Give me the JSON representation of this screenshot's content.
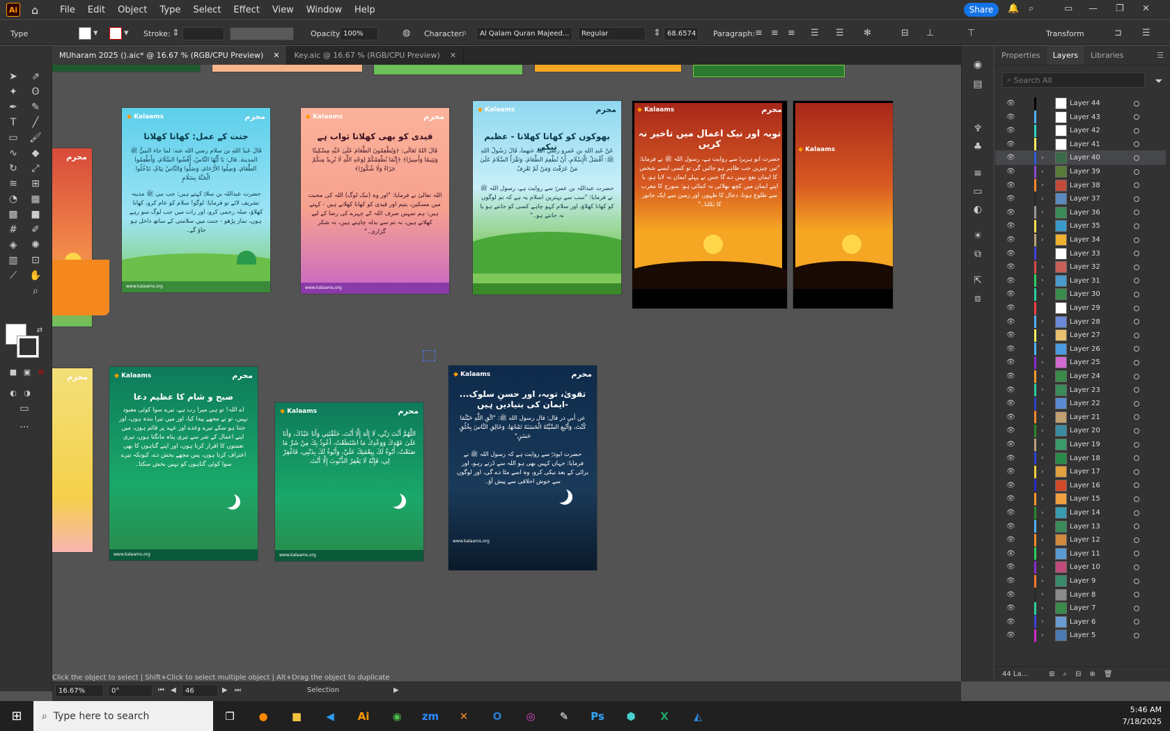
{
  "app": {
    "logo": "Ai",
    "menus": [
      "File",
      "Edit",
      "Object",
      "Type",
      "Select",
      "Effect",
      "View",
      "Window",
      "Help"
    ],
    "share": "Share"
  },
  "control": {
    "mode": "Type",
    "stroke_label": "Stroke:",
    "opacity_label": "Opacity:",
    "opacity": "100%",
    "character_label": "Character:",
    "font": "Al Qalam Quran Majeed...",
    "style": "Regular",
    "size": "68.6574 p",
    "paragraph_label": "Paragraph:",
    "transform": "Transform"
  },
  "tabs": [
    {
      "label": "MUharam 2025 ().aic* @ 16.67 % (RGB/CPU Preview)"
    },
    {
      "label": "Key.aic @ 16.67 % (RGB/CPU Preview)"
    }
  ],
  "panel": {
    "tabs": [
      "Properties",
      "Layers",
      "Libraries"
    ],
    "search_placeholder": "Search All",
    "footer": "44 La..."
  },
  "layers": [
    {
      "name": "Layer 44",
      "color": "#000000",
      "thumb": "#ffffff",
      "arrow": ""
    },
    {
      "name": "Layer 43",
      "color": "#4fb3ff",
      "thumb": "#ffffff",
      "arrow": ""
    },
    {
      "name": "Layer 42",
      "color": "#2bd6c8",
      "thumb": "#ffffff",
      "arrow": ""
    },
    {
      "name": "Layer 41",
      "color": "#ffef5c",
      "thumb": "#ffffff",
      "arrow": ""
    },
    {
      "name": "Layer 40",
      "color": "#2e5bd8",
      "thumb": "#3a6a4a",
      "arrow": "›",
      "selected": true
    },
    {
      "name": "Layer 39",
      "color": "#8a4ad0",
      "thumb": "#5a7a3a",
      "arrow": "›"
    },
    {
      "name": "Layer 38",
      "color": "#ff8a2b",
      "thumb": "#c24a3a",
      "arrow": "›"
    },
    {
      "name": "Layer 37",
      "color": "#2a2a2a",
      "thumb": "#5a8abf",
      "arrow": "›"
    },
    {
      "name": "Layer 36",
      "color": "#9a9a9a",
      "thumb": "#3a8a5a",
      "arrow": "›"
    },
    {
      "name": "Layer 35",
      "color": "#ffe04a",
      "thumb": "#3a9ac8",
      "arrow": "›"
    },
    {
      "name": "Layer 34",
      "color": "#bba37a",
      "thumb": "#f0b030",
      "arrow": "›"
    },
    {
      "name": "Layer 33",
      "color": "#4040e0",
      "thumb": "#ffffff",
      "arrow": ""
    },
    {
      "name": "Layer 32",
      "color": "#e04a4a",
      "thumb": "#c8605a",
      "arrow": "›"
    },
    {
      "name": "Layer 31",
      "color": "#2ad060",
      "thumb": "#4a9acb",
      "arrow": "›"
    },
    {
      "name": "Layer 30",
      "color": "#2ad0a0",
      "thumb": "#3a8a4a",
      "arrow": "›"
    },
    {
      "name": "Layer 29",
      "color": "#ff4040",
      "thumb": "#ffffff",
      "arrow": ""
    },
    {
      "name": "Layer 28",
      "color": "#4fb3ff",
      "thumb": "#6a8ad8",
      "arrow": "›"
    },
    {
      "name": "Layer 27",
      "color": "#ffef5c",
      "thumb": "#e8c070",
      "arrow": "›"
    },
    {
      "name": "Layer 26",
      "color": "#4fb3ff",
      "thumb": "#4a9ae0",
      "arrow": "›"
    },
    {
      "name": "Layer 25",
      "color": "#8a2ad0",
      "thumb": "#d06ad0",
      "arrow": "›"
    },
    {
      "name": "Layer 24",
      "color": "#ff9a2b",
      "thumb": "#3a8a4a",
      "arrow": "›"
    },
    {
      "name": "Layer 23",
      "color": "#2ad0a0",
      "thumb": "#3a8a5a",
      "arrow": "›"
    },
    {
      "name": "Layer 22",
      "color": "#2a40c8",
      "thumb": "#5a8ad0",
      "arrow": "›"
    },
    {
      "name": "Layer 21",
      "color": "#ff8a2b",
      "thumb": "#c0a070",
      "arrow": "›"
    },
    {
      "name": "Layer 20",
      "color": "#2a8a2a",
      "thumb": "#3a8aa0",
      "arrow": "›"
    },
    {
      "name": "Layer 19",
      "color": "#bba37a",
      "thumb": "#3a9a6a",
      "arrow": "›"
    },
    {
      "name": "Layer 18",
      "color": "#2a40e0",
      "thumb": "#2a8a4a",
      "arrow": "›"
    },
    {
      "name": "Layer 17",
      "color": "#ffd040",
      "thumb": "#e0a040",
      "arrow": "›"
    },
    {
      "name": "Layer 16",
      "color": "#2a2ad0",
      "thumb": "#d04a2a",
      "arrow": "›"
    },
    {
      "name": "Layer 15",
      "color": "#ff9a2b",
      "thumb": "#f0a040",
      "arrow": "›"
    },
    {
      "name": "Layer 14",
      "color": "#2a8a2a",
      "thumb": "#3a9ab0",
      "arrow": "›"
    },
    {
      "name": "Layer 13",
      "color": "#4fb3ff",
      "thumb": "#3a8a5a",
      "arrow": "›"
    },
    {
      "name": "Layer 12",
      "color": "#ff8a2b",
      "thumb": "#d08a40",
      "arrow": "›"
    },
    {
      "name": "Layer 11",
      "color": "#2ad060",
      "thumb": "#5a9ad0",
      "arrow": "›"
    },
    {
      "name": "Layer 10",
      "color": "#8a2ad0",
      "thumb": "#c04a7a",
      "arrow": "›"
    },
    {
      "name": "Layer 9",
      "color": "#ff7a2b",
      "thumb": "#3a8a6a",
      "arrow": "›"
    },
    {
      "name": "Layer 8",
      "color": "#2a2a2a",
      "thumb": "#8a8a8a",
      "arrow": "›"
    },
    {
      "name": "Layer 7",
      "color": "#2ad0a0",
      "thumb": "#3a8a4a",
      "arrow": "›"
    },
    {
      "name": "Layer 6",
      "color": "#4040e0",
      "thumb": "#6a9ad0",
      "arrow": "›"
    },
    {
      "name": "Layer 5",
      "color": "#d02ad0",
      "thumb": "#4a7ab0",
      "arrow": "›"
    }
  ],
  "artboards": [
    {
      "title": "جنت کے عمل: کھانا کھلانا",
      "body": "قَالَ عَبدُ اللهِ بن سلام رضي الله عنه: لما جاء النبيُّ ﷺ المدينة. قال: يَا أَيُّهَا النَّاسُ، أَفْشُوا السَّلَامَ، وَأَطْعِمُوا الطَّعَامَ، وَصِلُوا الأَرْحَامَ، وَصَلُّوا وَالنَّاسُ نِيَامٌ، تَدْخُلُوا الْجَنَّةَ بِسَلَامٍ",
      "body2": "حضرت عبداللہ بن سلامؓ کہتے ہیں: جب نبی ﷺ مدینہ تشریف لائے تو فرمایا: لوگو! سلام کو عام کرو، کھانا کھلاؤ، صلہ رحمی کرو، اور رات میں جب لوگ سو رہے ہوں، نماز پڑھو - جنت میں سلامتی کے ساتھ داخل ہو جاؤ گے۔"
    },
    {
      "title": "قیدی کو بھی کھلانا ثواب ہے",
      "body": "قَالَ اللهُ تَعَالَى: ﴿وَيُطْعِمُونَ الطَّعَامَ عَلَىٰ حُبِّهِ مِسْكِينًا وَيَتِيمًا وَأَسِيرًا﴾ ﴿إِنَّمَا نُطْعِمُكُمْ لِوَجْهِ اللَّهِ لَا نُرِيدُ مِنكُمْ جَزَاءً وَلَا شُكُورًا﴾",
      "body2": "اللہ تعالیٰ نے فرمایا: \"اور وہ (نیک لوگ) اللہ کی محبت میں مسکین، یتیم اور قیدی کو کھانا کھلاتے ہیں - کہتے ہیں: ہم تمہیں صرف اللہ کے چہرے کی رضا کے لیے کھلاتے ہیں، نہ تم سے بدلہ چاہتے ہیں، نہ شکر گزاری۔\""
    },
    {
      "title": "بھوکوں کو کھانا کھلانا - عظیم نیکی",
      "body": "عَنْ عَبدِ اللهِ بنِ عَمرو رضي الله عنهما، قَالَ رَسُولُ اللهِ ﷺ: أَفْضَلُ الْإِسْلَامِ، أَنْ تُطْعِمَ الطَّعَامَ، وَتَقْرَأَ السَّلَامَ عَلَىٰ مَنْ عَرَفْتَ وَمَنْ لَمْ تَعْرِفْ",
      "body2": "حضرت عبداللہ بن عمروؓ سے روایت ہے، رسول اللہ ﷺ نے فرمایا: \"سب سے بہترین اسلام یہ ہے کہ تم لوگوں کو کھانا کھلاؤ، اور سلام کہو چاہے کسی کو جانتے ہو یا نہ جانتے ہو۔\""
    },
    {
      "title": "توبہ اور نیک اعمال میں تاخیر نہ کریں",
      "body2": "حضرت ابو ہریرہؓ سے روایت ہے، رسول اللہ ﷺ نے فرمایا: \"تین چیزیں جب ظاہر ہو جائیں گی تو کسی ایسے شخص کا ایمان نفع نہیں دے گا جس نے پہلے ایمان نہ لایا ہو، یا اپنے ایمان میں کچھ بھلائی نہ کمائی ہو: سورج کا مغرب سے طلوع ہونا، دجال کا ظہور، اور زمین سے ایک جانور کا نکلنا۔\""
    },
    {
      "title": "صبح و شام کا عظیم دعا",
      "body2": "اے اللہ! تو ہی میرا رب ہے، تیرے سوا کوئی معبود نہیں، تو نے مجھے پیدا کیا، اور میں تیرا بندہ ہوں، اور جتنا ہو سکے تیرے وعدے اور عہد پر قائم ہوں، میں اپنے اعمال کے شر سے تیری پناہ مانگتا ہوں، تیری نعمتوں کا اقرار کرتا ہوں، اور اپنے گناہوں کا بھی اعتراف کرتا ہوں، پس مجھے بخش دے، کیونکہ تیرے سوا کوئی گناہوں کو نہیں بخش سکتا۔"
    },
    {
      "body": "اللَّهُمَّ أَنْتَ رَبِّي، لَا إِلَٰهَ إِلَّا أَنْتَ، خَلَقْتَنِي وَأَنَا عَبْدُكَ، وَأَنَا عَلَىٰ عَهْدِكَ وَوَعْدِكَ مَا اسْتَطَعْتُ، أَعُوذُ بِكَ مِنْ شَرِّ مَا صَنَعْتُ، أَبُوءُ لَكَ بِنِعْمَتِكَ عَلَيَّ، وَأَبُوءُ لَكَ بِذَنْبِي، فَاغْفِرْ لِي، فَإِنَّهُ لَا يَغْفِرُ الذُّنُوبَ إِلَّا أَنْتَ."
    },
    {
      "title": "تقویٰ، توبہ، اور حسنِ سلوک... ایمان کی بنیادیں ہیں-",
      "body": "عن أبي ذر قال: قال رسول الله ﷺ: \"اتَّقِ اللَّهِ حَيْثُمَا كُنْتَ، وَأَتْبِعِ السَّيِّئَةَ الْحَسَنَةَ تَمْحُهَا، وَخَالِقِ النَّاسَ بِخُلُقٍ حَسَنٍ\"",
      "body2": "حضرت ابوذرؓ سے روایت ہے کہ رسول اللہ ﷺ نے فرمایا: جہاں کہیں بھی ہو اللہ سے ڈرتے رہو، اور برائی کے بعد نیکی کرو، وہ اسے مٹا دے گی، اور لوگوں سے خوش اخلاقی سے پیش آؤ۔"
    }
  ],
  "brand": {
    "logo": "Kalaams",
    "badge": "محرم",
    "url": "www.kalaams.org"
  },
  "status": {
    "zoom": "16.67%",
    "rotate": "0°",
    "artboard": "46",
    "tool": "Selection",
    "hint": "Click the object to select  |  Shift+Click to select multiple object  |  Alt+Drag the object to duplicate"
  },
  "taskbar": {
    "search": "Type here to search",
    "time": "5:46 AM",
    "date": "7/18/2025"
  }
}
